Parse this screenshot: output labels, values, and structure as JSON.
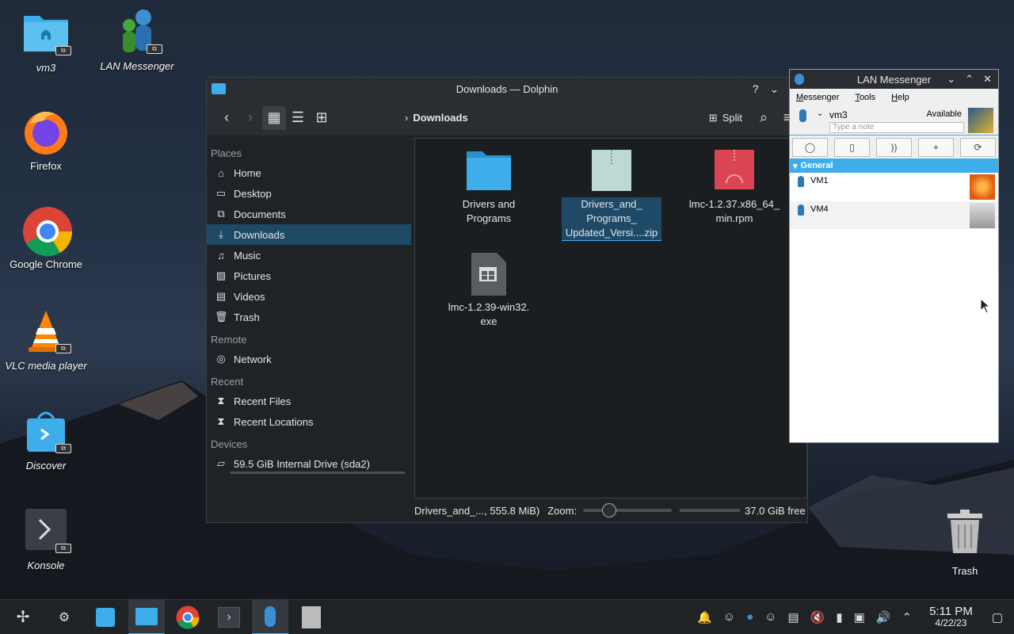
{
  "desktop": {
    "icons": [
      {
        "label": "vm3"
      },
      {
        "label": "LAN Messenger"
      },
      {
        "label": "Firefox"
      },
      {
        "label": "Google Chrome"
      },
      {
        "label": "VLC media player"
      },
      {
        "label": "Discover"
      },
      {
        "label": "Konsole"
      }
    ],
    "trash_label": "Trash"
  },
  "dolphin": {
    "title": "Downloads — Dolphin",
    "breadcrumb": "Downloads",
    "split_label": "Split",
    "places": {
      "places_header": "Places",
      "items": [
        "Home",
        "Desktop",
        "Documents",
        "Downloads",
        "Music",
        "Pictures",
        "Videos",
        "Trash"
      ],
      "remote_header": "Remote",
      "remote_items": [
        "Network"
      ],
      "recent_header": "Recent",
      "recent_items": [
        "Recent Files",
        "Recent Locations"
      ],
      "devices_header": "Devices",
      "device_items": [
        "59.5 GiB Internal Drive (sda2)"
      ]
    },
    "files": [
      {
        "line1": "Drivers and",
        "line2": "Programs",
        "line3": ""
      },
      {
        "line1": "Drivers_and_",
        "line2": "Programs_",
        "line3": "Updated_Versi....zip"
      },
      {
        "line1": "lmc-1.2.37.x86_64_",
        "line2": "min.rpm",
        "line3": ""
      },
      {
        "line1": "lmc-1.2.39-win32.",
        "line2": "exe",
        "line3": ""
      }
    ],
    "status": {
      "selection": "Drivers_and_..., 555.8 MiB)",
      "zoom_label": "Zoom:",
      "free_space": "37.0 GiB free"
    }
  },
  "lan_messenger": {
    "title": "LAN Messenger",
    "menu": [
      "Messenger",
      "Tools",
      "Help"
    ],
    "user_name": "vm3",
    "status": "Available",
    "note_placeholder": "Type a note",
    "group": "General",
    "contacts": [
      "VM1",
      "VM4"
    ]
  },
  "taskbar": {
    "time": "5:11 PM",
    "date": "4/22/23"
  },
  "colors": {
    "accent": "#3daee9",
    "selection": "#1e4a68"
  }
}
